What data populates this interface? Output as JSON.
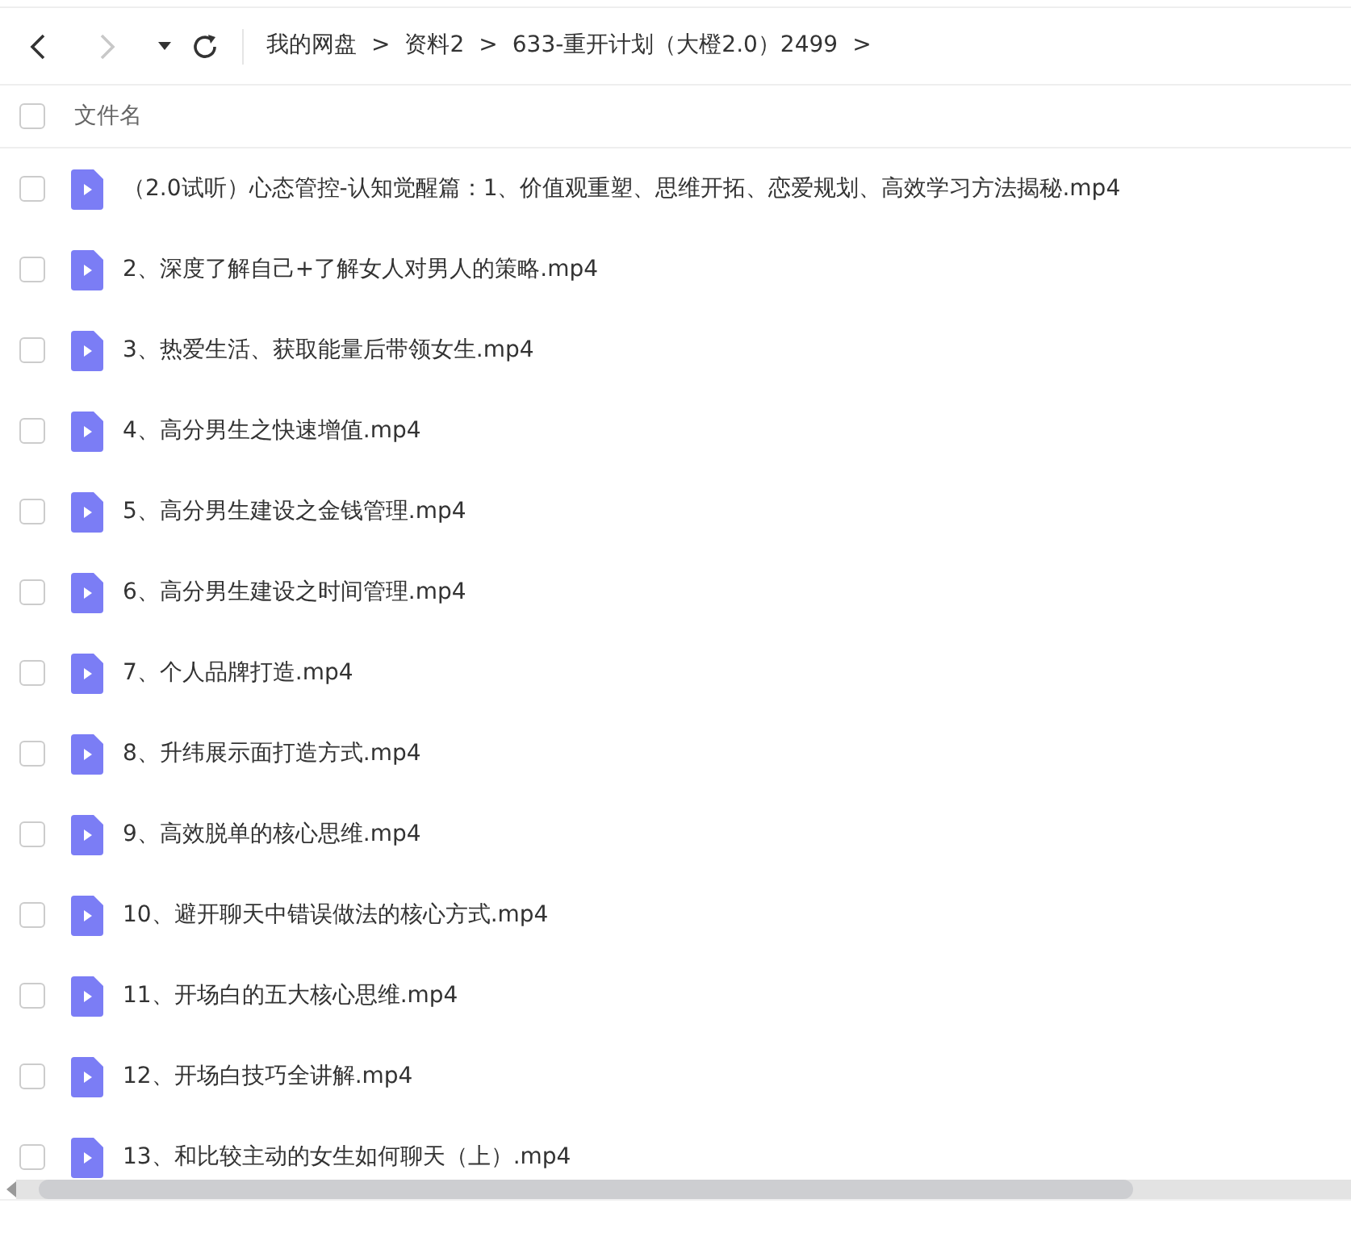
{
  "toolbar": {
    "back": {
      "disabled": false
    },
    "forward": {
      "disabled": true
    },
    "breadcrumbs": [
      {
        "label": "我的网盘"
      },
      {
        "label": "资料2"
      },
      {
        "label": "633-重开计划（大橙2.0）2499"
      }
    ],
    "separator": ">"
  },
  "header": {
    "label": "文件名",
    "checked": false
  },
  "files": [
    {
      "name": "（2.0试听）心态管控-认知觉醒篇：1、价值观重塑、思维开拓、恋爱规划、高效学习方法揭秘.mp4",
      "checked": false
    },
    {
      "name": "2、深度了解自己+了解女人对男人的策略.mp4",
      "checked": false
    },
    {
      "name": "3、热爱生活、获取能量后带领女生.mp4",
      "checked": false
    },
    {
      "name": "4、高分男生之快速增值.mp4",
      "checked": false
    },
    {
      "name": "5、高分男生建设之金钱管理.mp4",
      "checked": false
    },
    {
      "name": "6、高分男生建设之时间管理.mp4",
      "checked": false
    },
    {
      "name": "7、个人品牌打造.mp4",
      "checked": false
    },
    {
      "name": "8、升纬展示面打造方式.mp4",
      "checked": false
    },
    {
      "name": "9、高效脱单的核心思维.mp4",
      "checked": false
    },
    {
      "name": "10、避开聊天中错误做法的核心方式.mp4",
      "checked": false
    },
    {
      "name": "11、开场白的五大核心思维.mp4",
      "checked": false
    },
    {
      "name": "12、开场白技巧全讲解.mp4",
      "checked": false
    },
    {
      "name": "13、和比较主动的女生如何聊天（上）.mp4",
      "checked": false
    }
  ]
}
